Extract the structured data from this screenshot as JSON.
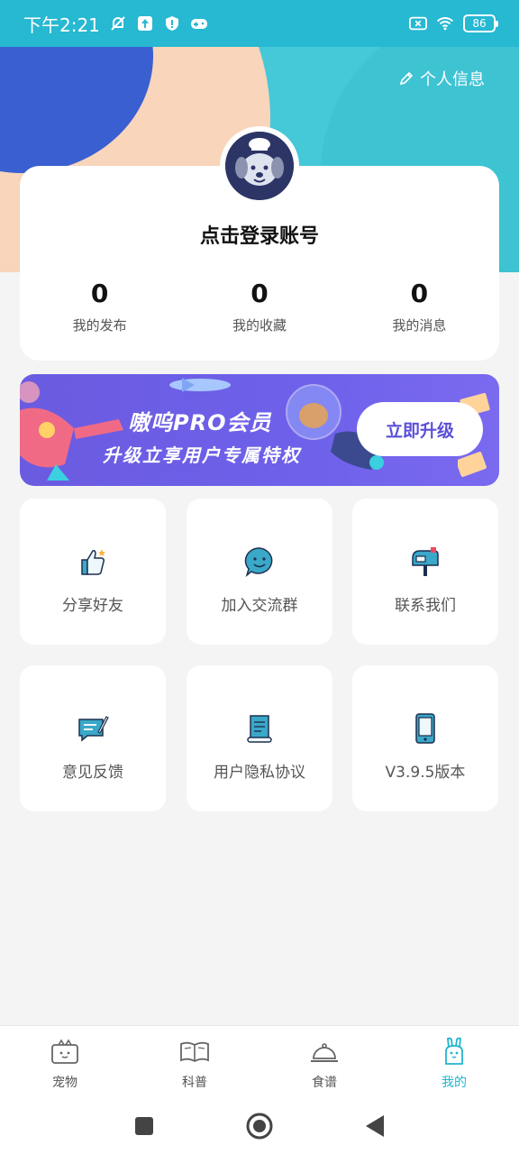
{
  "status_bar": {
    "time": "下午2:21",
    "battery": "86"
  },
  "header": {
    "profile_link": "个人信息"
  },
  "profile": {
    "login_prompt": "点击登录账号",
    "stats": [
      {
        "value": "0",
        "label": "我的发布"
      },
      {
        "value": "0",
        "label": "我的收藏"
      },
      {
        "value": "0",
        "label": "我的消息"
      }
    ]
  },
  "pro_banner": {
    "title": "嗷呜PRO会员",
    "subtitle": "升级立享用户专属特权",
    "button_label": "立即升级"
  },
  "grid": [
    {
      "label": "分享好友",
      "icon": "thumbs-up-icon"
    },
    {
      "label": "加入交流群",
      "icon": "chat-bubble-icon"
    },
    {
      "label": "联系我们",
      "icon": "mailbox-icon"
    },
    {
      "label": "意见反馈",
      "icon": "feedback-icon"
    },
    {
      "label": "用户隐私协议",
      "icon": "scroll-icon"
    },
    {
      "label": "V3.9.5版本",
      "icon": "phone-icon"
    }
  ],
  "bottom_nav": [
    {
      "label": "宠物",
      "icon": "pet-icon"
    },
    {
      "label": "科普",
      "icon": "book-icon"
    },
    {
      "label": "食谱",
      "icon": "cloche-icon"
    },
    {
      "label": "我的",
      "icon": "bunny-icon",
      "active": true
    }
  ],
  "colors": {
    "accent": "#22b4cf",
    "status_bar": "#27b8d2",
    "banner": "#6e61ea"
  }
}
